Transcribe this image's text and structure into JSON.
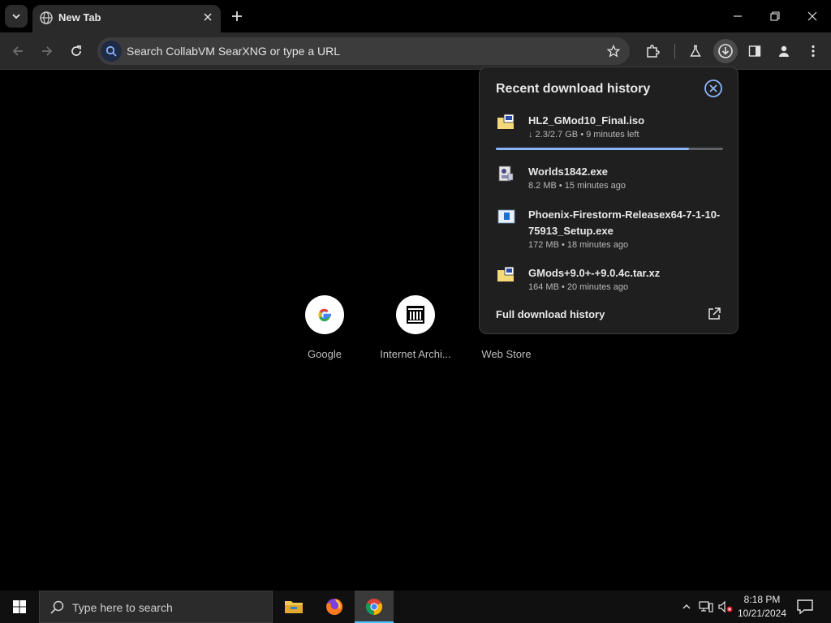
{
  "browser": {
    "tab": {
      "title": "New Tab"
    },
    "omnibox": {
      "placeholder": "Search CollabVM SearXNG or type a URL"
    }
  },
  "shortcuts": [
    {
      "label": "Google"
    },
    {
      "label": "Internet Archi..."
    },
    {
      "label": "Web Store"
    }
  ],
  "downloads": {
    "title": "Recent download history",
    "items": [
      {
        "name": "HL2_GMod10_Final.iso",
        "meta": "↓ 2.3/2.7 GB • 9 minutes left",
        "progress": 0.85
      },
      {
        "name": "Worlds1842.exe",
        "meta": "8.2 MB • 15 minutes ago"
      },
      {
        "name": "Phoenix-Firestorm-Releasex64-7-1-10-75913_Setup.exe",
        "meta": "172 MB • 18 minutes ago"
      },
      {
        "name": "GMods+9.0+-+9.0.4c.tar.xz",
        "meta": "164 MB • 20 minutes ago"
      }
    ],
    "full_history_label": "Full download history"
  },
  "taskbar": {
    "search_placeholder": "Type here to search",
    "time": "8:18 PM",
    "date": "10/21/2024"
  },
  "colors": {
    "accent": "#8ab4f8",
    "taskbar_active": "#4cc2ff"
  }
}
